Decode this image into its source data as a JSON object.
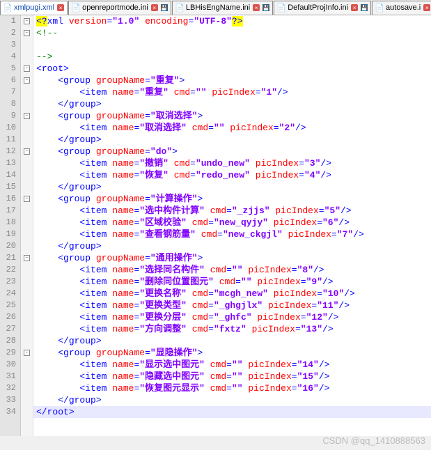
{
  "tabs": [
    {
      "label": "xmlpugi.xml",
      "active": true,
      "dirty": false
    },
    {
      "label": "openreportmode.ini",
      "active": false,
      "dirty": true
    },
    {
      "label": "LBHisEngName.ini",
      "active": false,
      "dirty": true
    },
    {
      "label": "DefaultProjInfo.ini",
      "active": false,
      "dirty": true
    },
    {
      "label": "autosave.i",
      "active": false,
      "dirty": false
    }
  ],
  "line_count": 34,
  "fold_marks": {
    "1": "minus",
    "2": "minus",
    "5": "minus",
    "6": "minus",
    "9": "minus",
    "12": "minus",
    "16": "minus",
    "21": "minus",
    "29": "minus"
  },
  "xml": {
    "prolog": {
      "open": "<?",
      "tag": "xml",
      "attrs": [
        [
          "version",
          "1.0"
        ],
        [
          "encoding",
          "UTF-8"
        ]
      ],
      "close": "?>"
    },
    "root": "root",
    "groups": [
      {
        "groupName": "重复",
        "items": [
          {
            "name": "重复",
            "cmd": "",
            "picIndex": "1"
          }
        ]
      },
      {
        "groupName": "取消选择",
        "items": [
          {
            "name": "取消选择",
            "cmd": "",
            "picIndex": "2"
          }
        ]
      },
      {
        "groupName": "do",
        "items": [
          {
            "name": "撤销",
            "cmd": "undo_new",
            "picIndex": "3"
          },
          {
            "name": "恢复",
            "cmd": "redo_new",
            "picIndex": "4"
          }
        ]
      },
      {
        "groupName": "计算操作",
        "items": [
          {
            "name": "选中构件计算",
            "cmd": "_zjjs",
            "picIndex": "5"
          },
          {
            "name": "区域校验",
            "cmd": "new_qyjy",
            "picIndex": "6"
          },
          {
            "name": "查看钢筋量",
            "cmd": "new_ckgjl",
            "picIndex": "7"
          }
        ]
      },
      {
        "groupName": "通用操作",
        "items": [
          {
            "name": "选择同名构件",
            "cmd": "",
            "picIndex": "8"
          },
          {
            "name": "删除同位置图元",
            "cmd": "",
            "picIndex": "9"
          },
          {
            "name": "更换名称",
            "cmd": "mcgh_new",
            "picIndex": "10"
          },
          {
            "name": "更换类型",
            "cmd": "_ghgjlx",
            "picIndex": "11"
          },
          {
            "name": "更换分层",
            "cmd": "_ghfc",
            "picIndex": "12"
          },
          {
            "name": "方向调整",
            "cmd": "fxtz",
            "picIndex": "13"
          }
        ]
      },
      {
        "groupName": "显隐操作",
        "items": [
          {
            "name": "显示选中图元",
            "cmd": "",
            "picIndex": "14"
          },
          {
            "name": "隐藏选中图元",
            "cmd": "",
            "picIndex": "15"
          },
          {
            "name": "恢复图元显示",
            "cmd": "",
            "picIndex": "16"
          }
        ]
      }
    ]
  },
  "watermark": "CSDN @qq_1410888563"
}
